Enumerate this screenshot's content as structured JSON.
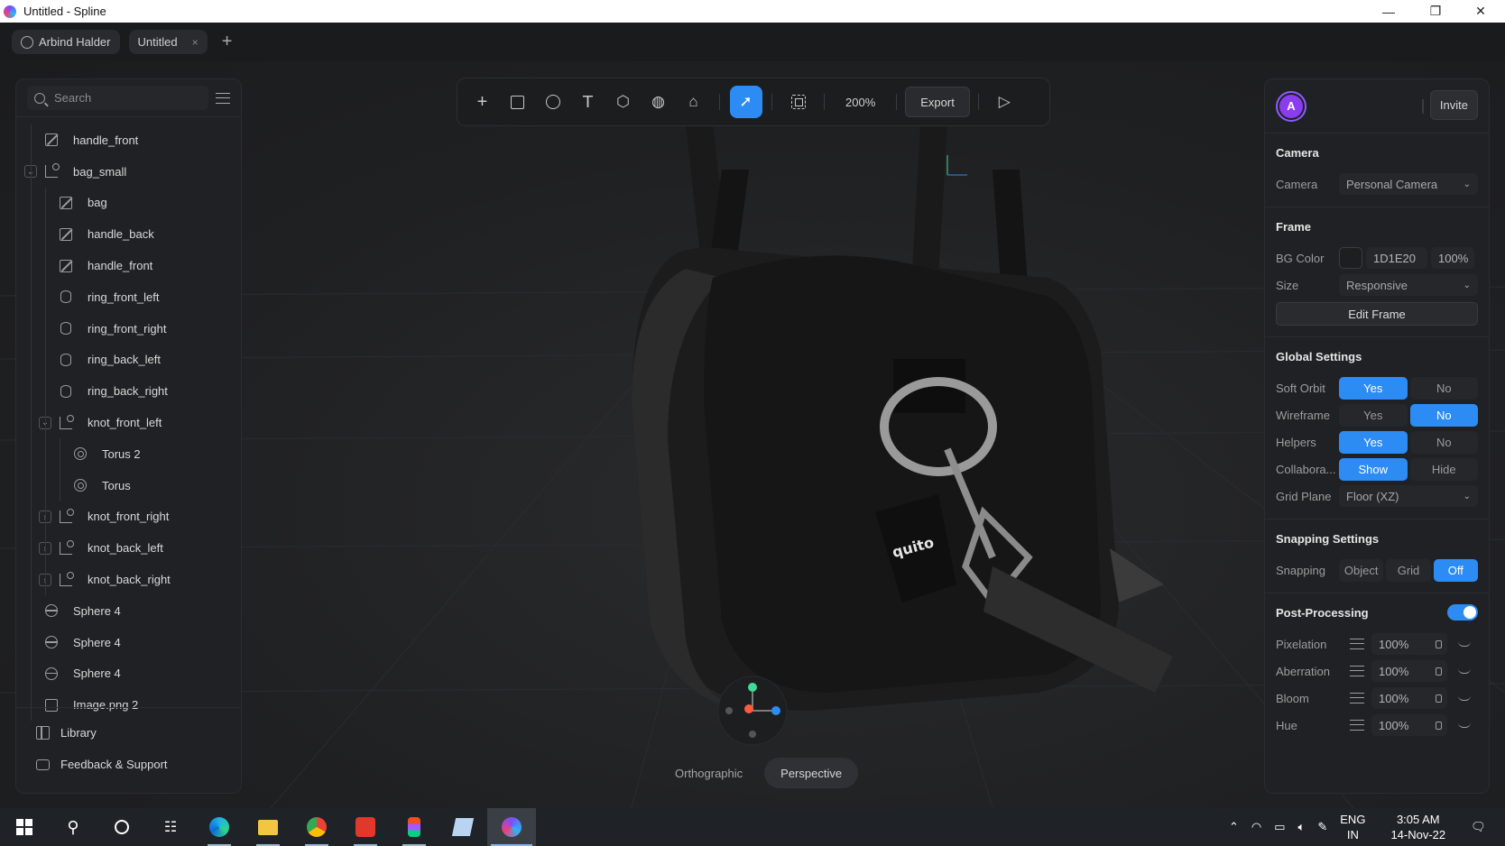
{
  "window": {
    "title": "Untitled - Spline"
  },
  "tabs": {
    "user": "Arbind Halder",
    "file": "Untitled",
    "close": "×",
    "add": "+"
  },
  "search": {
    "placeholder": "Search"
  },
  "layers": [
    {
      "name": "handle_front",
      "icon": "shape",
      "level": 0,
      "chev": ""
    },
    {
      "name": "bag_small",
      "icon": "group",
      "level": 0,
      "chev": "open"
    },
    {
      "name": "bag",
      "icon": "shape",
      "level": 1,
      "chev": ""
    },
    {
      "name": "handle_back",
      "icon": "shape",
      "level": 1,
      "chev": ""
    },
    {
      "name": "handle_front",
      "icon": "shape",
      "level": 1,
      "chev": ""
    },
    {
      "name": "ring_front_left",
      "icon": "cylinder",
      "level": 1,
      "chev": ""
    },
    {
      "name": "ring_front_right",
      "icon": "cylinder",
      "level": 1,
      "chev": ""
    },
    {
      "name": "ring_back_left",
      "icon": "cylinder",
      "level": 1,
      "chev": ""
    },
    {
      "name": "ring_back_right",
      "icon": "cylinder",
      "level": 1,
      "chev": ""
    },
    {
      "name": "knot_front_left",
      "icon": "group",
      "level": 1,
      "chev": "open"
    },
    {
      "name": "Torus 2",
      "icon": "torus",
      "level": 2,
      "chev": ""
    },
    {
      "name": "Torus",
      "icon": "torus",
      "level": 2,
      "chev": ""
    },
    {
      "name": "knot_front_right",
      "icon": "group",
      "level": 1,
      "chev": "closed"
    },
    {
      "name": "knot_back_left",
      "icon": "group",
      "level": 1,
      "chev": "closed"
    },
    {
      "name": "knot_back_right",
      "icon": "group",
      "level": 1,
      "chev": "closed"
    },
    {
      "name": "Sphere 4",
      "icon": "sphere",
      "level": 0,
      "chev": ""
    },
    {
      "name": "Sphere 4",
      "icon": "sphere",
      "level": 0,
      "chev": ""
    },
    {
      "name": "Sphere 4",
      "icon": "sphere",
      "level": 0,
      "chev": ""
    },
    {
      "name": "Image.png 2",
      "icon": "image",
      "level": 0,
      "chev": ""
    }
  ],
  "left_footer": {
    "library": "Library",
    "feedback": "Feedback & Support"
  },
  "toolbar": {
    "zoom": "200%",
    "export": "Export"
  },
  "right": {
    "avatar_letter": "A",
    "invite": "Invite",
    "camera": {
      "title": "Camera",
      "label": "Camera",
      "value": "Personal Camera"
    },
    "frame": {
      "title": "Frame",
      "bg_label": "BG Color",
      "bg_hex": "1D1E20",
      "bg_opacity": "100%",
      "size_label": "Size",
      "size_value": "Responsive",
      "edit": "Edit Frame"
    },
    "global": {
      "title": "Global Settings",
      "soft_orbit": {
        "label": "Soft Orbit",
        "a": "Yes",
        "b": "No"
      },
      "wireframe": {
        "label": "Wireframe",
        "a": "Yes",
        "b": "No"
      },
      "helpers": {
        "label": "Helpers",
        "a": "Yes",
        "b": "No"
      },
      "collab": {
        "label": "Collabora...",
        "a": "Show",
        "b": "Hide"
      },
      "grid": {
        "label": "Grid Plane",
        "value": "Floor (XZ)"
      }
    },
    "snapping": {
      "title": "Snapping Settings",
      "label": "Snapping",
      "a": "Object",
      "b": "Grid",
      "c": "Off"
    },
    "post": {
      "title": "Post-Processing",
      "rows": [
        {
          "label": "Pixelation",
          "value": "100%"
        },
        {
          "label": "Aberration",
          "value": "100%"
        },
        {
          "label": "Bloom",
          "value": "100%"
        },
        {
          "label": "Hue",
          "value": "100%"
        }
      ]
    }
  },
  "viewport": {
    "tag_text": "quito"
  },
  "viewmode": {
    "ortho": "Orthographic",
    "persp": "Perspective"
  },
  "taskbar": {
    "lang1": "ENG",
    "lang2": "IN",
    "time": "3:05 AM",
    "date": "14-Nov-22"
  },
  "colors": {
    "accent": "#2c8cf4",
    "avatar": "#8a3cf0",
    "bg": "#1d1e20"
  }
}
